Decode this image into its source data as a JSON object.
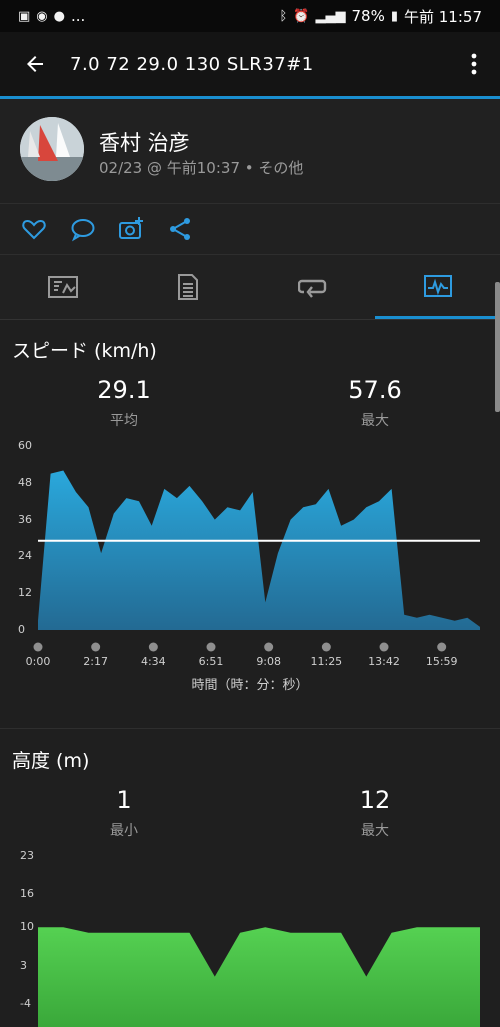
{
  "status_bar": {
    "left_icons": [
      "image-icon",
      "messenger-icon",
      "line-icon"
    ],
    "ellipsis": "...",
    "battery": "78%",
    "time": "午前 11:57"
  },
  "header": {
    "title": "7.0  72  29.0  130  SLR37#1"
  },
  "profile": {
    "name": "香村 治彦",
    "meta": "02/23 @ 午前10:37 • その他"
  },
  "actions": [
    "like-icon",
    "comment-icon",
    "add-photo-icon",
    "share-icon"
  ],
  "tabs": [
    "summary-tab",
    "details-tab",
    "laps-tab",
    "charts-tab"
  ],
  "colors": {
    "accent": "#1a8fd0",
    "speed_fill": "#2aa3d6",
    "elevation_fill": "#4cc84a"
  },
  "speed": {
    "title": "スピード (km/h)",
    "avg_value": "29.1",
    "avg_label": "平均",
    "max_value": "57.6",
    "max_label": "最大",
    "x_title": "時間（時：分：秒）",
    "y_ticks": [
      "60",
      "48",
      "36",
      "24",
      "12",
      "0"
    ],
    "x_ticks": [
      "0:00",
      "2:17",
      "4:34",
      "6:51",
      "9:08",
      "11:25",
      "13:42",
      "15:59"
    ]
  },
  "elevation": {
    "title": "高度 (m)",
    "min_value": "1",
    "min_label": "最小",
    "max_value": "12",
    "max_label": "最大",
    "y_ticks": [
      "23",
      "16",
      "10",
      "3",
      "-4"
    ]
  },
  "chart_data": [
    {
      "type": "area",
      "title": "スピード (km/h)",
      "xlabel": "時間（時：分：秒）",
      "ylabel": "km/h",
      "ylim": [
        0,
        60
      ],
      "x": [
        "0:00",
        "0:30",
        "1:00",
        "1:30",
        "2:00",
        "2:30",
        "3:00",
        "3:30",
        "4:00",
        "4:30",
        "5:00",
        "5:30",
        "6:00",
        "6:30",
        "7:00",
        "7:30",
        "8:00",
        "8:30",
        "9:00",
        "9:30",
        "10:00",
        "10:30",
        "11:00",
        "11:30",
        "12:00",
        "12:30",
        "13:00",
        "13:30",
        "14:00",
        "14:30",
        "15:00",
        "15:30",
        "16:00",
        "16:30",
        "17:00",
        "17:30"
      ],
      "series": [
        {
          "values": [
            3,
            51,
            52,
            45,
            40,
            25,
            38,
            43,
            42,
            34,
            46,
            43,
            47,
            42,
            36,
            40,
            39,
            45,
            9,
            25,
            36,
            40,
            41,
            46,
            34,
            36,
            40,
            42,
            46,
            5,
            4,
            5,
            4,
            3,
            4,
            1
          ]
        }
      ],
      "reference_line": {
        "value": 29.1
      },
      "grid": false
    },
    {
      "type": "area",
      "title": "高度 (m)",
      "ylim": [
        -4,
        23
      ],
      "x": [
        "0:00",
        "1:00",
        "2:00",
        "3:00",
        "4:00",
        "5:00",
        "6:00",
        "7:00",
        "8:00",
        "9:00",
        "10:00",
        "11:00",
        "12:00",
        "13:00",
        "14:00",
        "15:00",
        "16:00",
        "17:00",
        "17:30"
      ],
      "series": [
        {
          "values": [
            10,
            10,
            9,
            9,
            9,
            9,
            9,
            1,
            9,
            10,
            9,
            9,
            9,
            1,
            9,
            10,
            10,
            10,
            10
          ]
        }
      ],
      "grid": false
    }
  ]
}
